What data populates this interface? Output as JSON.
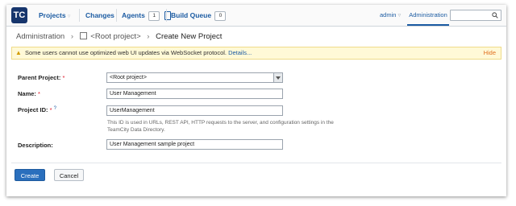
{
  "logo": {
    "text": "TC"
  },
  "nav": {
    "projects": "Projects",
    "changes": "Changes",
    "agents": "Agents",
    "agents_count": "1",
    "build_queue": "Build Queue",
    "build_queue_count": "0",
    "dropdown_glyph": "▿"
  },
  "user": {
    "name": "admin"
  },
  "admin_link": "Administration",
  "search": {
    "placeholder": "",
    "icon": "search-icon"
  },
  "breadcrumb": {
    "root": "Administration",
    "project": "<Root project>",
    "current": "Create New Project",
    "separator": "›"
  },
  "warning": {
    "text": "Some users cannot use optimized web UI updates via WebSocket protocol.",
    "link": "Details...",
    "hide": "Hide"
  },
  "form": {
    "parent_label": "Parent Project:",
    "parent_value": "<Root project>",
    "name_label": "Name:",
    "name_value": "User Management",
    "id_label": "Project ID:",
    "id_value": "UserManagement",
    "id_help": "This ID is used in URLs, REST API, HTTP requests to the server, and configuration settings in the TeamCity Data Directory.",
    "desc_label": "Description:",
    "desc_value": "User Management sample project",
    "required_mark": "*",
    "info_mark": "?"
  },
  "buttons": {
    "create": "Create",
    "cancel": "Cancel"
  },
  "colors": {
    "accent": "#1b5ba2",
    "primary_button": "#2a6fbd",
    "warning_bg": "#fff9d7",
    "hide_link": "#e07020",
    "required": "#dd1122"
  }
}
